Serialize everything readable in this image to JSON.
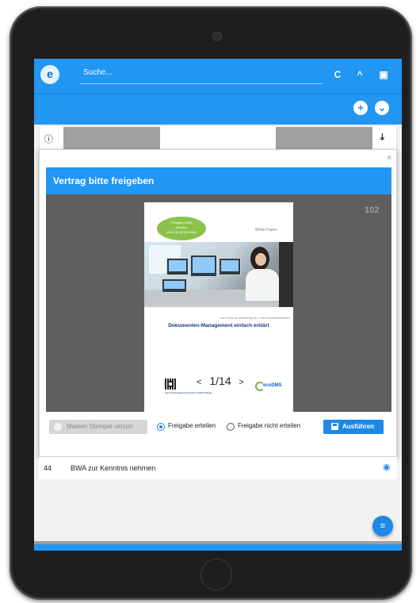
{
  "appbar": {
    "logo_label": "e",
    "search_placeholder": "Suche...",
    "refresh_glyph": "C",
    "collapse_glyph": "^",
    "id_glyph": "▣"
  },
  "toolbar": {
    "add_glyph": "+",
    "more_glyph": "⌄"
  },
  "background_row": {
    "info_glyph": "ⓘ",
    "download_glyph": "⤓"
  },
  "dialog": {
    "close_glyph": "×",
    "title": "Vertrag bitte freigeben",
    "page_number": "102",
    "document": {
      "badge_lines": [
        "Freigabe erteilt",
        "sendero",
        "2024-06-28 15:43:08"
      ],
      "header": "White Paper",
      "subtitle": "Von A wie Archivierung bis Z wie Zusammenarbeit",
      "title": "Dokumenten-Management einfach erklärt",
      "url_text": "https://whitepaperdownload.ecoDMS-Ablage",
      "logo_text": "ecoDMS"
    },
    "pager": {
      "prev_glyph": "<",
      "current": "1/14",
      "next_glyph": ">"
    },
    "actions": {
      "stamp_label": "Meinen Stempel setzen",
      "radio_approve_label": "Freigabe erteilen",
      "radio_reject_label": "Freigabe nicht erteilen",
      "execute_label": "Ausführen",
      "selected": "approve"
    }
  },
  "list": {
    "row_number": "44",
    "row_text": "BWA zur Kenntnis nehmen",
    "eye_glyph": "◉"
  },
  "fab_glyph": "≡",
  "colors": {
    "primary": "#2196f3",
    "accent_button": "#1e88e5",
    "badge_green": "#8bc34a",
    "doc_title_blue": "#1a3a7a"
  }
}
